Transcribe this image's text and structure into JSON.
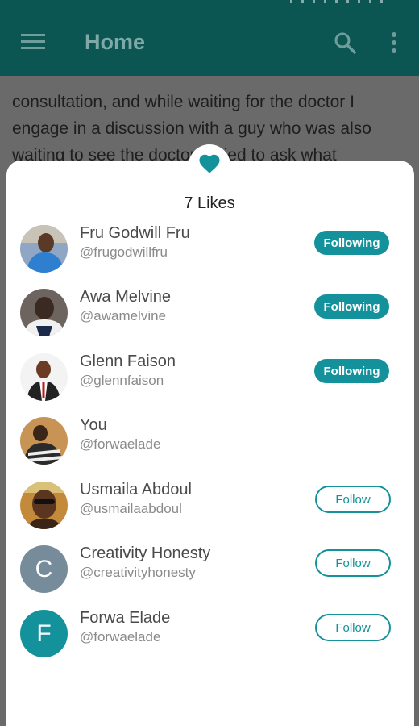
{
  "app_bar": {
    "title": "Home"
  },
  "post": {
    "text": "consultation, and while waiting for the doctor I engage in a discussion with a guy who was also waiting to see the doctor. I tried to ask what"
  },
  "likes": {
    "title": "7 Likes",
    "accent_color": "#14929c",
    "users": [
      {
        "name": "Fru Godwill Fru",
        "handle": "@frugodwillfru",
        "button": "Following",
        "state": "following",
        "avatar": "photo"
      },
      {
        "name": "Awa Melvine",
        "handle": "@awamelvine",
        "button": "Following",
        "state": "following",
        "avatar": "photo"
      },
      {
        "name": "Glenn Faison",
        "handle": "@glennfaison",
        "button": "Following",
        "state": "following",
        "avatar": "photo"
      },
      {
        "name": "You",
        "handle": "@forwaelade",
        "button": "",
        "state": "self",
        "avatar": "photo"
      },
      {
        "name": "Usmaila Abdoul",
        "handle": "@usmailaabdoul",
        "button": "Follow",
        "state": "follow",
        "avatar": "photo"
      },
      {
        "name": "Creativity Honesty",
        "handle": "@creativityhonesty",
        "button": "Follow",
        "state": "follow",
        "avatar_letter": "C",
        "avatar_color": "#768c9a"
      },
      {
        "name": "Forwa Elade",
        "handle": "@forwaelade",
        "button": "Follow",
        "state": "follow",
        "avatar_letter": "F",
        "avatar_color": "#14929c"
      }
    ]
  }
}
